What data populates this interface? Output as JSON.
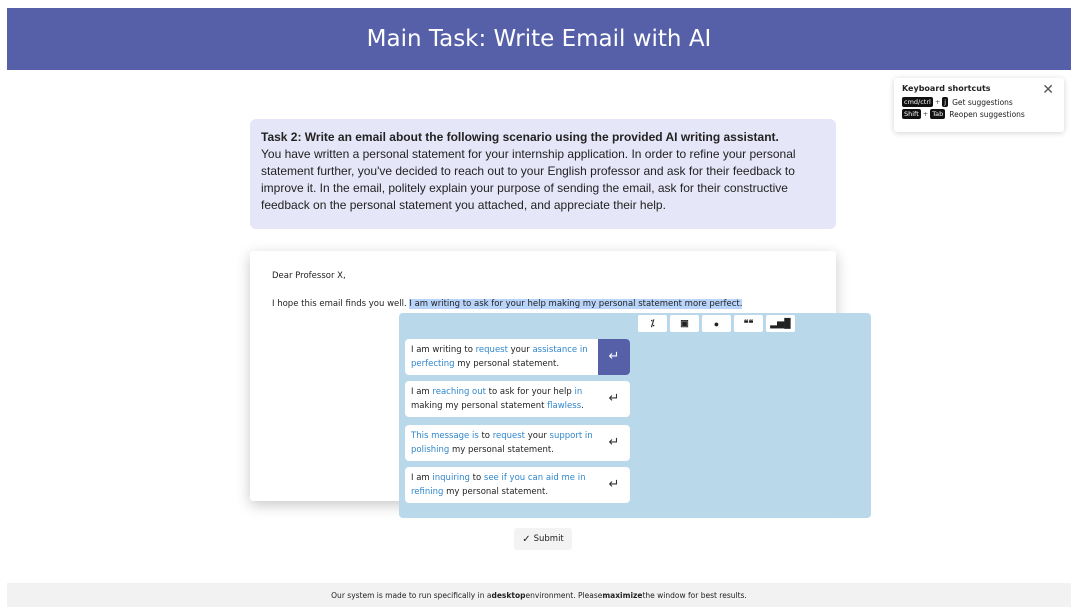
{
  "header": {
    "title": "Main Task: Write Email with AI"
  },
  "shortcuts": {
    "title": "Keyboard shortcuts",
    "close_icon": "close-icon",
    "rows": [
      {
        "keys": [
          "cmd/ctrl",
          "j"
        ],
        "label": "Get suggestions"
      },
      {
        "keys": [
          "Shift",
          "Tab"
        ],
        "label": "Reopen suggestions"
      }
    ],
    "plus": "+"
  },
  "task": {
    "title": "Task 2: Write an email about the following scenario using the provided AI writing assistant.",
    "body": "You have written a personal statement for your internship application. In order to refine your personal statement further, you've decided to reach out to your English professor and ask for their feedback to improve it. In the email, politely explain your purpose of sending the email, ask for their constructive feedback on the personal statement you attached, and appreciate their help."
  },
  "editor": {
    "greeting": "Dear Professor X,",
    "line_plain": "I hope this email finds you well. ",
    "line_selected": "I am writing to ask for your help making my personal statement more perfect."
  },
  "toolbar": {
    "buttons": [
      {
        "name": "percent-icon",
        "glyph": "⁒"
      },
      {
        "name": "id-card-icon",
        "glyph": "▣"
      },
      {
        "name": "comment-icon",
        "glyph": "●"
      },
      {
        "name": "quote-icon",
        "glyph": "❝❝"
      },
      {
        "name": "bar-chart-icon",
        "glyph": "▂▅█"
      }
    ]
  },
  "suggestions": [
    {
      "parts": [
        [
          "I am writing to ",
          false
        ],
        [
          "request",
          true
        ],
        [
          " your ",
          false
        ],
        [
          "assistance in perfecting",
          true
        ],
        [
          " my personal statement.",
          false
        ]
      ],
      "active": true
    },
    {
      "parts": [
        [
          "I am ",
          false
        ],
        [
          "reaching out",
          true
        ],
        [
          " to ask for your help ",
          false
        ],
        [
          "in",
          true
        ],
        [
          " making my personal statement ",
          false
        ],
        [
          "flawless",
          true
        ],
        [
          ".",
          false
        ]
      ],
      "active": false
    },
    {
      "parts": [
        [
          "This message is",
          true
        ],
        [
          " to ",
          false
        ],
        [
          "request",
          true
        ],
        [
          " your ",
          false
        ],
        [
          "support in polishing",
          true
        ],
        [
          " my personal statement.",
          false
        ]
      ],
      "active": false
    },
    {
      "parts": [
        [
          "I am ",
          false
        ],
        [
          "inquiring",
          true
        ],
        [
          " to ",
          false
        ],
        [
          "see if you can aid me in refining",
          true
        ],
        [
          " my personal statement.",
          false
        ]
      ],
      "active": false
    }
  ],
  "enter_glyph": "↵",
  "submit": {
    "icon": "✓",
    "label": "Submit"
  },
  "footer": {
    "parts": [
      [
        "Our system is made to run specifically in a ",
        false
      ],
      [
        "desktop",
        true
      ],
      [
        " environment. Please ",
        false
      ],
      [
        "maximize",
        true
      ],
      [
        " the window for best results.",
        false
      ]
    ]
  },
  "colors": {
    "header": "#5560a9",
    "task_bg": "#e6e6f9",
    "panel_bg": "#b9d8ea",
    "highlight": "#2f86cc"
  }
}
